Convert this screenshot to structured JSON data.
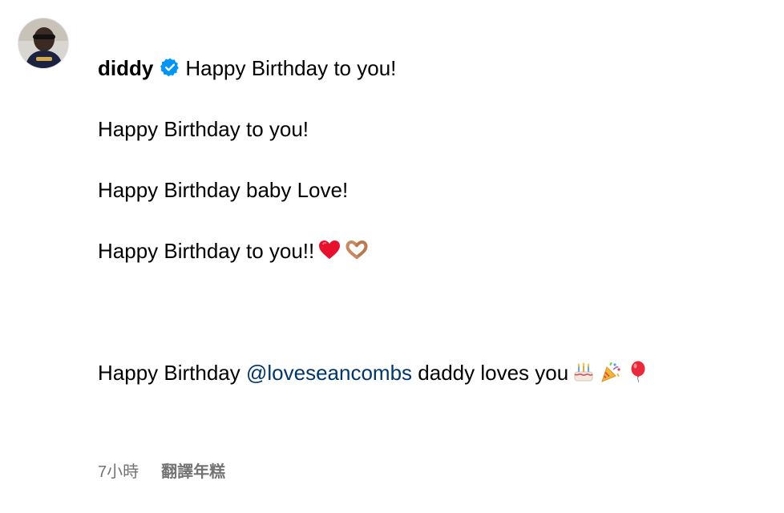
{
  "comment": {
    "username": "diddy",
    "verified": true,
    "lines": [
      "Happy Birthday to you!",
      "Happy Birthday to you!",
      "Happy Birthday baby Love!",
      "Happy Birthday to you!!"
    ],
    "line4_emojis": [
      "red-heart-icon",
      "heart-hands-icon"
    ],
    "last_line": {
      "prefix": "Happy Birthday ",
      "mention": "@loveseancombs",
      "suffix": " daddy loves you",
      "emojis": [
        "birthday-cake-icon",
        "party-popper-icon",
        "balloon-icon"
      ]
    },
    "timestamp": "7小時",
    "translate_label": "翻譯年糕"
  },
  "colors": {
    "verified_badge": "#0095f6",
    "mention": "#00376b",
    "meta_text": "#737373"
  }
}
